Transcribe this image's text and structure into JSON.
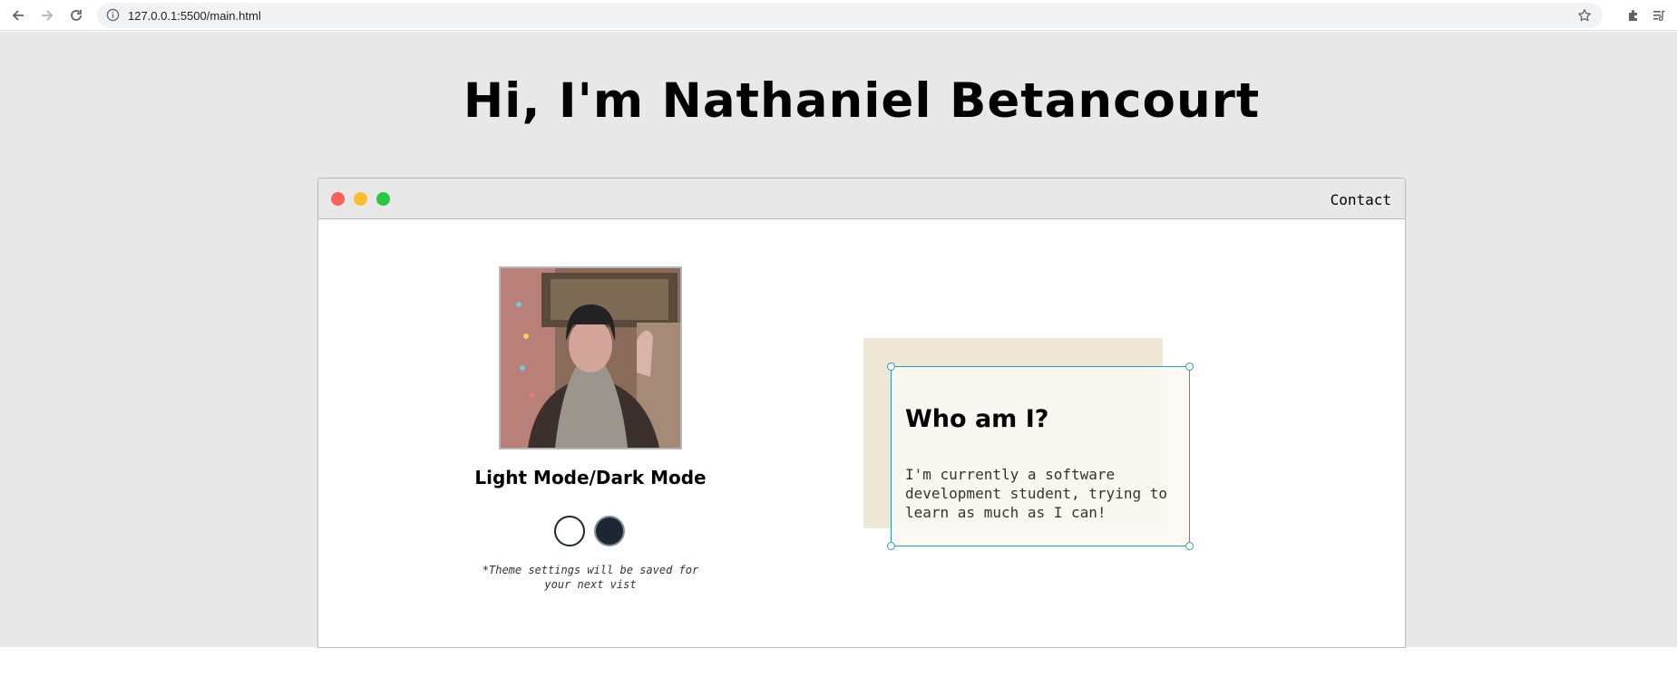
{
  "browser": {
    "url": "127.0.0.1:5500/main.html"
  },
  "page": {
    "heading": "Hi, I'm Nathaniel Betancourt"
  },
  "window": {
    "traffic_lights": {
      "close": "#ff5f57",
      "minimize": "#febc2e",
      "maximize": "#28c840"
    },
    "nav": {
      "contact_label": "Contact"
    }
  },
  "profile": {
    "mode_title": "Light Mode/Dark Mode",
    "theme_options": [
      {
        "name": "light",
        "color": "#ffffff"
      },
      {
        "name": "dark",
        "color": "#1c2733"
      }
    ],
    "theme_note": "*Theme settings will be saved for your next vist"
  },
  "about": {
    "title": "Who am I?",
    "text": "I'm currently a software development student, trying to learn as much as I can!"
  },
  "colors": {
    "viewport_bg": "#e8e8e8",
    "card_bg": "#efe7d6",
    "selection_accent": "#2a9fb1"
  }
}
